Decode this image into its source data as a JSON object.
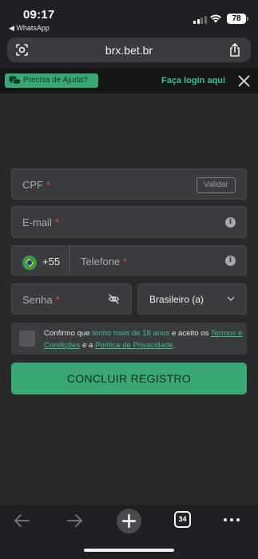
{
  "status_bar": {
    "time": "09:17",
    "back_app": "◀ WhatsApp",
    "battery": "78"
  },
  "browser": {
    "url": "brx.bet.br",
    "tab_count": "34"
  },
  "site_header": {
    "help_label": "Precisa de Ajuda?",
    "login_label": "Faça login aqui"
  },
  "form": {
    "cpf": {
      "placeholder": "CPF",
      "required_mark": "*",
      "validate_label": "Validar"
    },
    "email": {
      "placeholder": "E-mail",
      "required_mark": "*"
    },
    "phone": {
      "country_code": "+55",
      "placeholder": "Telefone",
      "required_mark": "*"
    },
    "password": {
      "placeholder": "Senha",
      "required_mark": "*"
    },
    "nationality": {
      "value": "Brasileiro (a)"
    },
    "consent": {
      "text_1": "Confirmo que ",
      "age_highlight": "tenho mais de 18 anos",
      "text_2": " e aceito os ",
      "terms_link": "Termos e Condições",
      "text_3": " e a ",
      "privacy_link": "Política de Privacidade",
      "text_4": "."
    },
    "submit_label": "CONCLUIR REGISTRO"
  },
  "info_icon_glyph": "i",
  "colors": {
    "accent": "#39a873",
    "link": "#3cc187",
    "background": "#28292b",
    "field": "#3a3b3e",
    "required": "#d6485a"
  }
}
